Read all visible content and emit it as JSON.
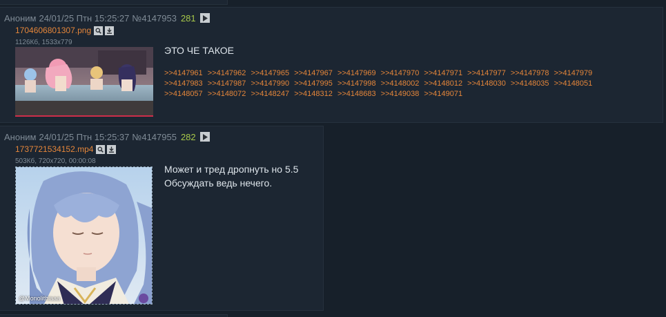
{
  "posts": [
    {
      "author": "Аноним",
      "date": "24/01/25 Птн 15:25:27",
      "number": "№4147953",
      "ordinal": "281",
      "file": {
        "name": "1704606801307.png",
        "meta": "1126Кб, 1533x779"
      },
      "text": [
        "ЭТО ЧЕ ТАКОЕ"
      ],
      "replies": [
        ">>4147961",
        ">>4147962",
        ">>4147965",
        ">>4147967",
        ">>4147969",
        ">>4147970",
        ">>4147971",
        ">>4147977",
        ">>4147978",
        ">>4147979",
        ">>4147983",
        ">>4147987",
        ">>4147990",
        ">>4147995",
        ">>4147998",
        ">>4148002",
        ">>4148012",
        ">>4148030",
        ">>4148035",
        ">>4148051",
        ">>4148057",
        ">>4148072",
        ">>4148247",
        ">>4148312",
        ">>4148683",
        ">>4149038",
        ">>4149071"
      ]
    },
    {
      "author": "Аноним",
      "date": "24/01/25 Птн 15:25:37",
      "number": "№4147955",
      "ordinal": "282",
      "file": {
        "name": "1737721534152.mp4",
        "meta": "503Кб, 720x720, 00:00:08",
        "watermark": "@Monolithiaaa"
      },
      "text": [
        "Может и тред дропнуть но 5.5",
        "Обсуждать ведь нечего."
      ],
      "replies": []
    }
  ],
  "colors": {
    "background": "#17202a",
    "post_bg": "#1c2632",
    "link": "#e5863a",
    "ordinal": "#a8c94a",
    "header": "#7f8b96"
  },
  "icons": [
    "play-icon",
    "search-icon",
    "download-icon"
  ]
}
